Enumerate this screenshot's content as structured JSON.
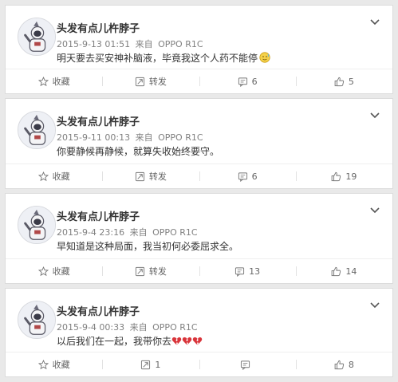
{
  "posts": [
    {
      "author": "头发有点儿杵脖子",
      "date": "2015-9-13 01:51",
      "source_prefix": "来自",
      "device": "OPPO R1C",
      "text": "明天要去买安神补脑液，毕竟我这个人药不能停",
      "trailing_emoji": "sweat-smile-emoji",
      "actions": {
        "favorite": "收藏",
        "repost": "转发",
        "comments": "6",
        "likes": "5"
      }
    },
    {
      "author": "头发有点儿杵脖子",
      "date": "2015-9-11 00:13",
      "source_prefix": "来自",
      "device": "OPPO R1C",
      "text": "你要静候再静候，就算失收始终要守。",
      "actions": {
        "favorite": "收藏",
        "repost": "转发",
        "comments": "6",
        "likes": "19"
      }
    },
    {
      "author": "头发有点儿杵脖子",
      "date": "2015-9-4 23:16",
      "source_prefix": "来自",
      "device": "OPPO R1C",
      "text": "早知道是这种局面，我当初何必委屈求全。",
      "actions": {
        "favorite": "收藏",
        "repost": "转发",
        "comments": "13",
        "likes": "14"
      }
    },
    {
      "author": "头发有点儿杵脖子",
      "date": "2015-9-4 00:33",
      "source_prefix": "来自",
      "device": "OPPO R1C",
      "text": "以后我们在一起，我带你去",
      "trailing_emoji": "broken-heart-emoji x3",
      "actions": {
        "favorite": "收藏",
        "repost": "1",
        "comments": "",
        "likes": "8"
      }
    }
  ],
  "colors": {
    "background": "#e9e9e9",
    "card": "#ffffff",
    "meta_text": "#808080",
    "broken_heart": "#d9343a"
  }
}
